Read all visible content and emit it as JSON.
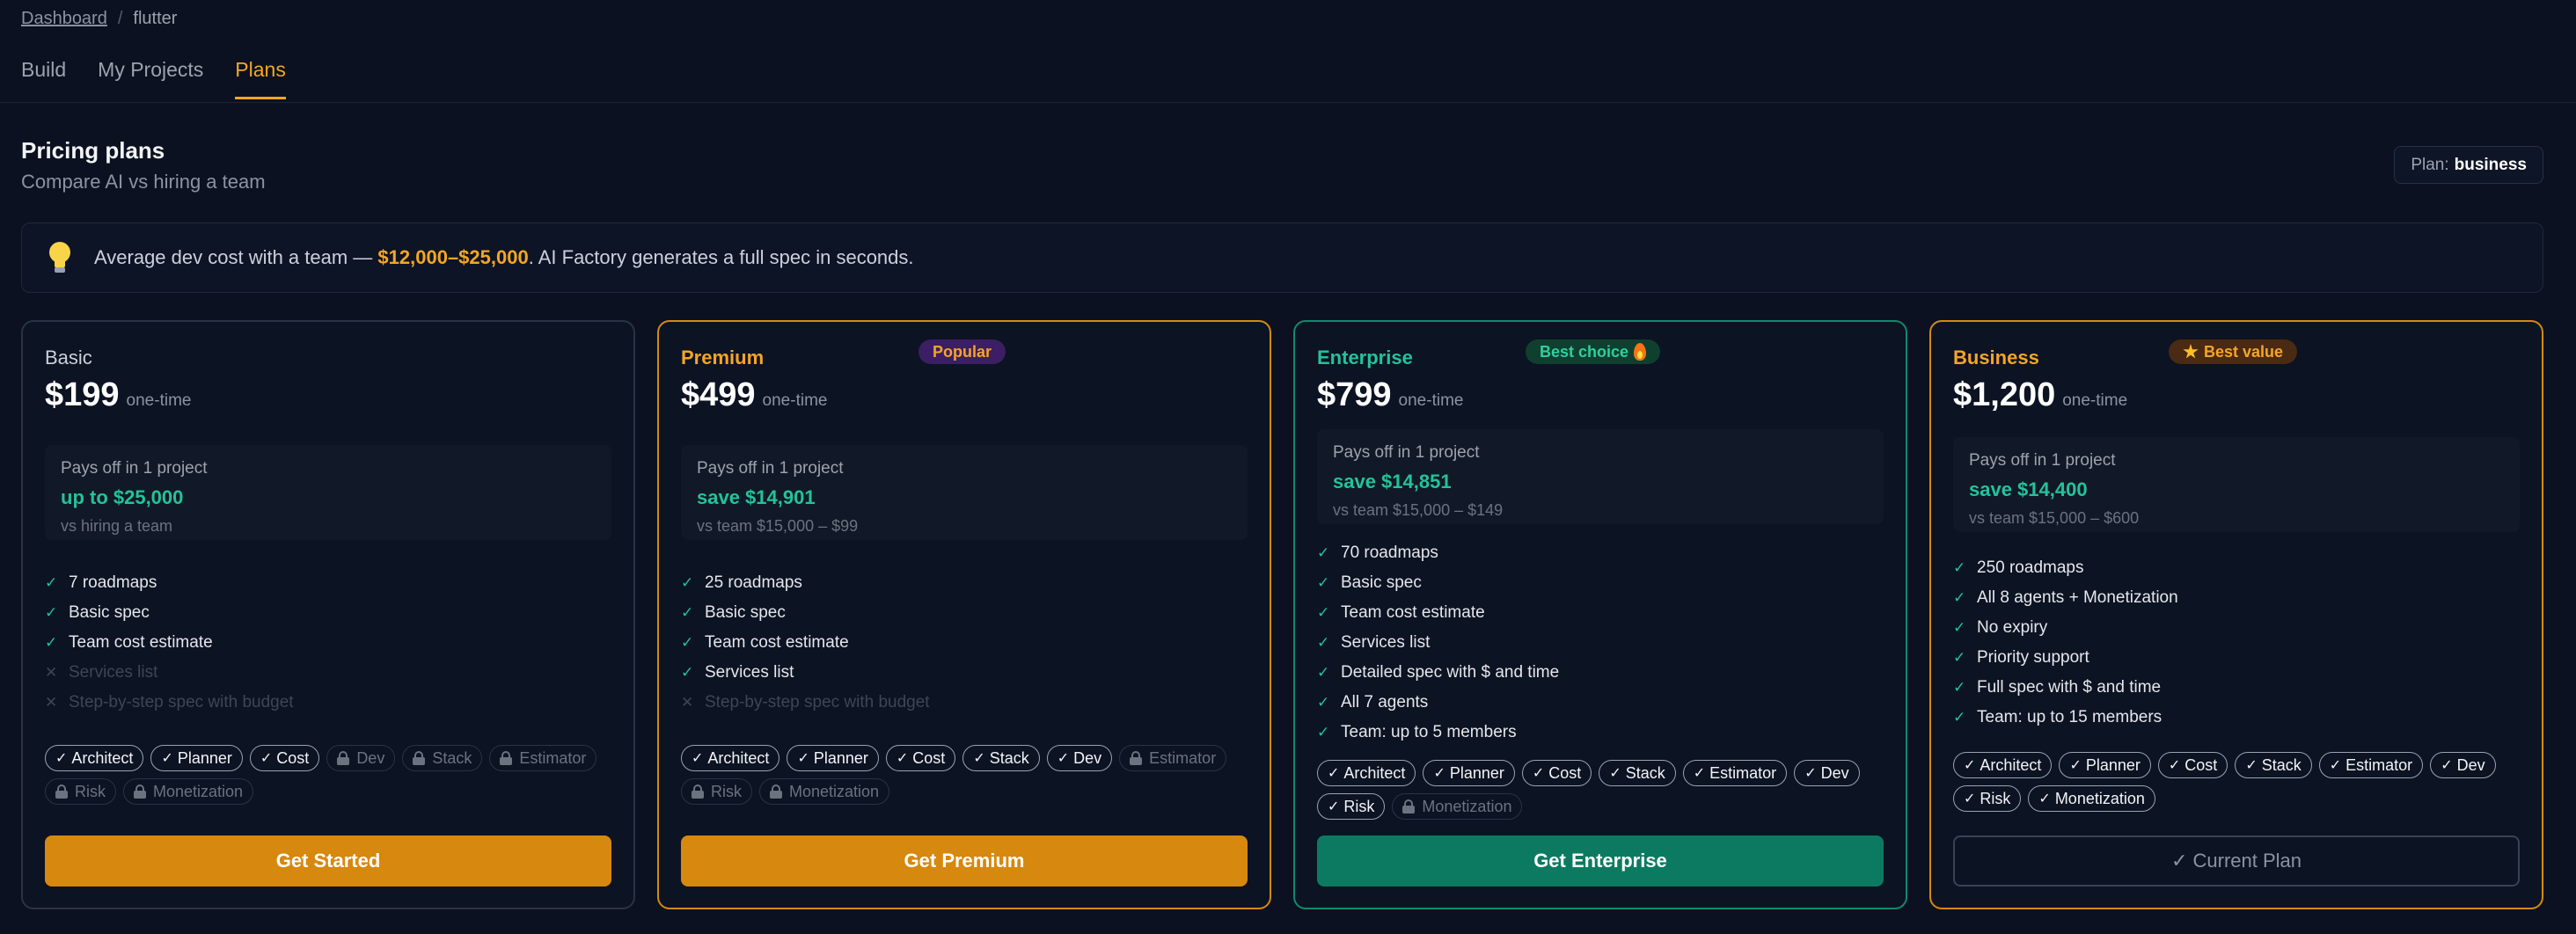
{
  "breadcrumb": {
    "root": "Dashboard",
    "separator": "/",
    "current": "flutter"
  },
  "tabs": [
    {
      "label": "Build",
      "active": false
    },
    {
      "label": "My Projects",
      "active": false
    },
    {
      "label": "Plans",
      "active": true
    }
  ],
  "header": {
    "title": "Pricing plans",
    "subtitle": "Compare AI vs hiring a team"
  },
  "plan_badge": {
    "label": "Plan:",
    "value": "business"
  },
  "banner": {
    "icon": "lightbulb-icon",
    "prefix": "Average dev cost with a team — ",
    "highlight": "$12,000–$25,000",
    "suffix": ". AI Factory generates a full spec in seconds."
  },
  "colors": {
    "accent": "#f5a524",
    "success": "#22c39a",
    "background": "#0b1120",
    "enterprise_button": "#0c7a61",
    "primary_button": "#d7880f"
  },
  "plans": [
    {
      "name": "Basic",
      "price": "$199",
      "price_unit": "one-time",
      "roi": {
        "line1": "Pays off in 1 project",
        "line2": "up to $25,000",
        "line3": "vs hiring a team"
      },
      "features": [
        {
          "text": "7 roadmaps",
          "included": true
        },
        {
          "text": "Basic spec",
          "included": true
        },
        {
          "text": "Team cost estimate",
          "included": true
        },
        {
          "text": "Services list",
          "included": false
        },
        {
          "text": "Step-by-step spec with budget",
          "included": false
        }
      ],
      "agents": [
        {
          "name": "Architect",
          "unlocked": true
        },
        {
          "name": "Planner",
          "unlocked": true
        },
        {
          "name": "Cost",
          "unlocked": true
        },
        {
          "name": "Dev",
          "unlocked": false
        },
        {
          "name": "Stack",
          "unlocked": false
        },
        {
          "name": "Estimator",
          "unlocked": false
        },
        {
          "name": "Risk",
          "unlocked": false
        },
        {
          "name": "Monetization",
          "unlocked": false
        }
      ],
      "button": "Get Started"
    },
    {
      "name": "Premium",
      "tag": "Popular",
      "price": "$499",
      "price_unit": "one-time",
      "roi": {
        "line1": "Pays off in 1 project",
        "line2": "save $14,901",
        "line3": "vs team $15,000 – $99"
      },
      "features": [
        {
          "text": "25 roadmaps",
          "included": true
        },
        {
          "text": "Basic spec",
          "included": true
        },
        {
          "text": "Team cost estimate",
          "included": true
        },
        {
          "text": "Services list",
          "included": true
        },
        {
          "text": "Step-by-step spec with budget",
          "included": false
        }
      ],
      "agents": [
        {
          "name": "Architect",
          "unlocked": true
        },
        {
          "name": "Planner",
          "unlocked": true
        },
        {
          "name": "Cost",
          "unlocked": true
        },
        {
          "name": "Stack",
          "unlocked": true
        },
        {
          "name": "Dev",
          "unlocked": true
        },
        {
          "name": "Estimator",
          "unlocked": false
        },
        {
          "name": "Risk",
          "unlocked": false
        },
        {
          "name": "Monetization",
          "unlocked": false
        }
      ],
      "button": "Get Premium"
    },
    {
      "name": "Enterprise",
      "tag": "Best choice",
      "price": "$799",
      "price_unit": "one-time",
      "roi": {
        "line1": "Pays off in 1 project",
        "line2": "save $14,851",
        "line3": "vs team $15,000 – $149"
      },
      "features": [
        {
          "text": "70 roadmaps",
          "included": true
        },
        {
          "text": "Basic spec",
          "included": true
        },
        {
          "text": "Team cost estimate",
          "included": true
        },
        {
          "text": "Services list",
          "included": true
        },
        {
          "text": "Detailed spec with $ and time",
          "included": true
        },
        {
          "text": "All 7 agents",
          "included": true
        },
        {
          "text": "Team: up to 5 members",
          "included": true
        }
      ],
      "agents": [
        {
          "name": "Architect",
          "unlocked": true
        },
        {
          "name": "Planner",
          "unlocked": true
        },
        {
          "name": "Cost",
          "unlocked": true
        },
        {
          "name": "Stack",
          "unlocked": true
        },
        {
          "name": "Estimator",
          "unlocked": true
        },
        {
          "name": "Dev",
          "unlocked": true
        },
        {
          "name": "Risk",
          "unlocked": true
        },
        {
          "name": "Monetization",
          "unlocked": false
        }
      ],
      "button": "Get Enterprise"
    },
    {
      "name": "Business",
      "tag": "Best value",
      "price": "$1,200",
      "price_unit": "one-time",
      "roi": {
        "line1": "Pays off in 1 project",
        "line2": "save $14,400",
        "line3": "vs team $15,000 – $600"
      },
      "features": [
        {
          "text": "250 roadmaps",
          "included": true
        },
        {
          "text": "All 8 agents + Monetization",
          "included": true
        },
        {
          "text": "No expiry",
          "included": true
        },
        {
          "text": "Priority support",
          "included": true
        },
        {
          "text": "Full spec with $ and time",
          "included": true
        },
        {
          "text": "Team: up to 15 members",
          "included": true
        }
      ],
      "agents": [
        {
          "name": "Architect",
          "unlocked": true
        },
        {
          "name": "Planner",
          "unlocked": true
        },
        {
          "name": "Cost",
          "unlocked": true
        },
        {
          "name": "Stack",
          "unlocked": true
        },
        {
          "name": "Estimator",
          "unlocked": true
        },
        {
          "name": "Dev",
          "unlocked": true
        },
        {
          "name": "Risk",
          "unlocked": true
        },
        {
          "name": "Monetization",
          "unlocked": true
        }
      ],
      "button": "✓ Current Plan"
    }
  ]
}
